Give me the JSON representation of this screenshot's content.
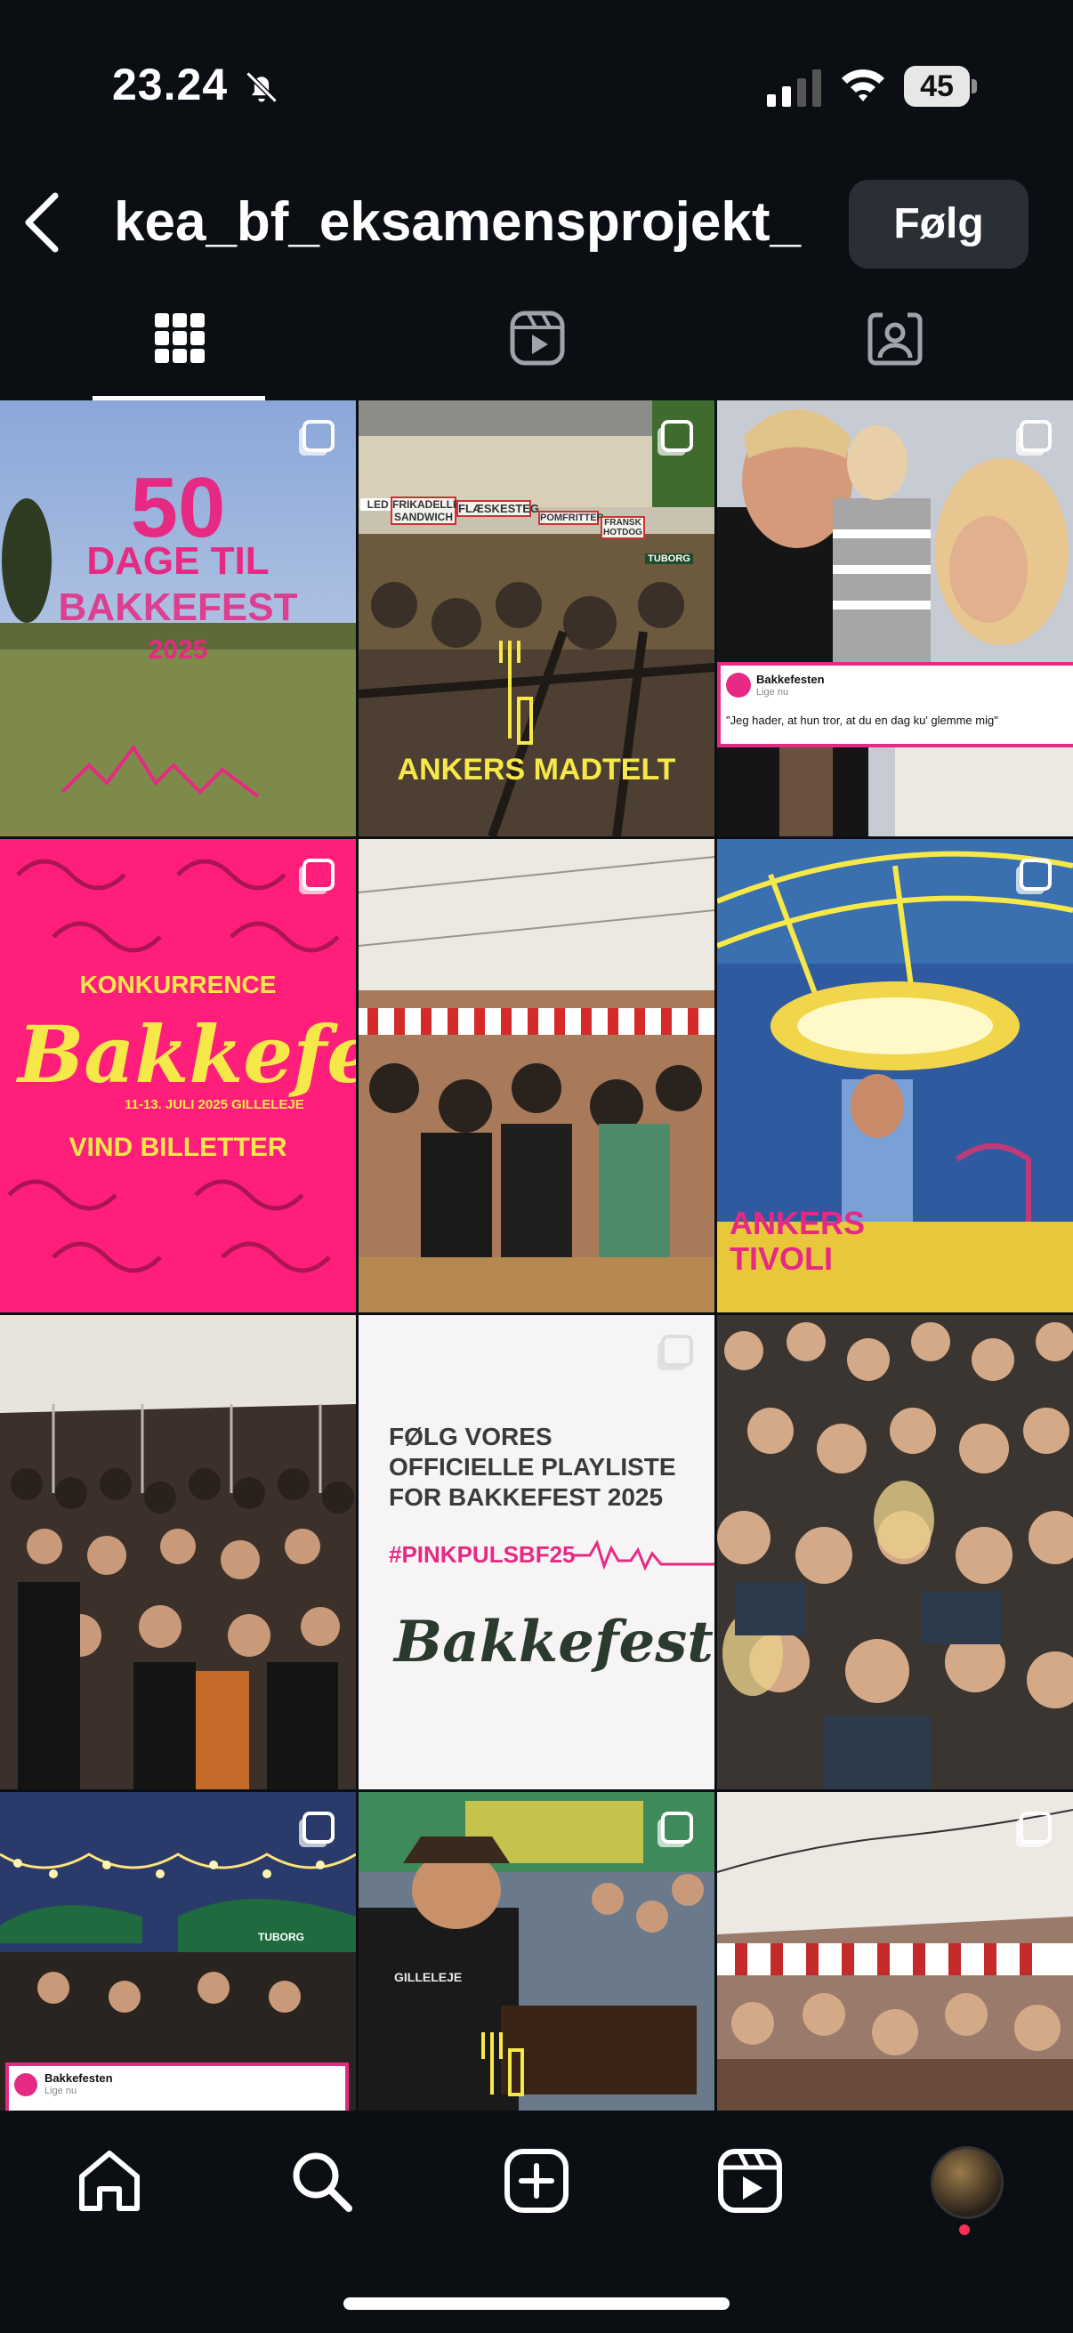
{
  "status": {
    "time": "23.24",
    "battery": "45"
  },
  "header": {
    "username": "kea_bf_eksamensprojekt_",
    "follow_label": "Følg"
  },
  "tabs": [
    {
      "name": "grid",
      "icon": "grid-icon",
      "active": true
    },
    {
      "name": "reels",
      "icon": "reels-icon",
      "active": false
    },
    {
      "name": "tagged",
      "icon": "tagged-icon",
      "active": false
    }
  ],
  "posts": {
    "p1": {
      "big": "50",
      "line1": "DAGE TIL",
      "line2": "BAKKEFEST",
      "year": "2025"
    },
    "p2": {
      "caption": "ANKERS MADTELT",
      "signs": [
        "LED RK",
        "FRIKADELLE SANDWICH",
        "FLÆSKESTEG",
        "POMFRITTER",
        "FRANSK HOTDOG",
        "TUBORG"
      ]
    },
    "p3": {
      "page": "Bakkefesten",
      "time": "Lige nu",
      "quote": "\"Jeg hader, at hun tror, at du en dag ku' glemme mig\""
    },
    "p4": {
      "title": "KONKURRENCE",
      "logo": "Bakkefest",
      "dates": "11-13. JULI 2025 GILLELEJE",
      "cta": "VIND BILLETTER"
    },
    "p6": {
      "line1": "ANKERS",
      "line2": "TIVOLI"
    },
    "p8": {
      "line1": "FØLG VORES",
      "line2": "OFFICIELLE PLAYLISTE",
      "line3": "FOR BAKKEFEST 2025",
      "hashtag": "#PINKPULSBF25",
      "logo": "Bakkefest"
    },
    "p10": {
      "page": "Bakkefesten",
      "time": "Lige nu",
      "sign": "TUBORG"
    },
    "p11": {
      "shirt": "GILLELEJE"
    }
  },
  "nav": [
    "home-icon",
    "search-icon",
    "create-icon",
    "reels-icon",
    "profile-avatar"
  ],
  "colors": {
    "background": "#0b0f14",
    "accent_pink": "#e62a84",
    "pink_bg": "#ff1f7a",
    "yellow": "#f7e84a"
  }
}
